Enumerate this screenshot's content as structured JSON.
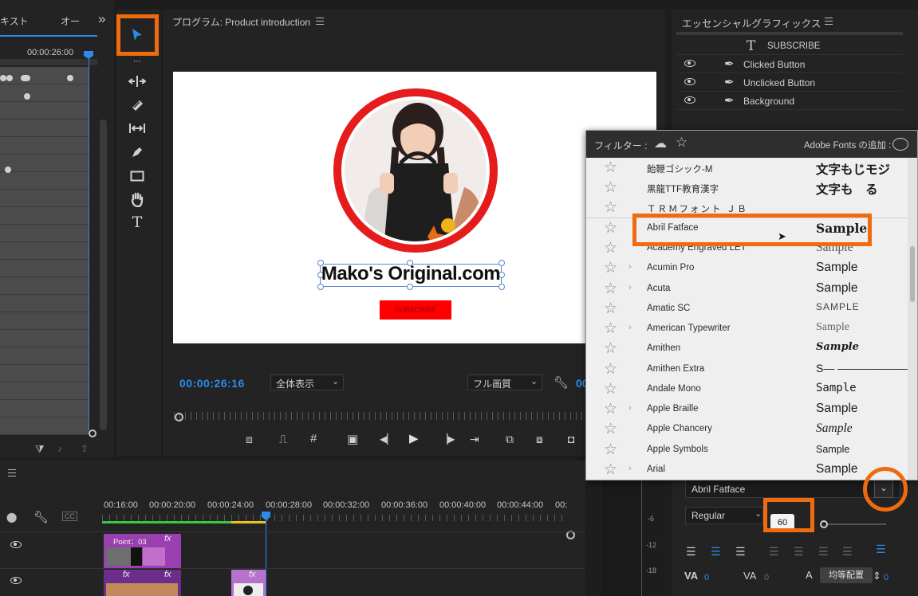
{
  "left_panel": {
    "tab_text": "キスト",
    "tab_audio": "オー",
    "more_glyph": "»",
    "timecode": "00:00:26:00"
  },
  "tools": {
    "items": [
      {
        "name": "selection-tool",
        "glyph": "➤"
      },
      {
        "name": "track-select-tool",
        "glyph": "⇶"
      },
      {
        "name": "ripple-edit-tool",
        "glyph": "✥"
      },
      {
        "name": "razor-tool",
        "glyph": "✂"
      },
      {
        "name": "slip-tool",
        "glyph": "↔"
      },
      {
        "name": "pen-tool",
        "glyph": "✒"
      },
      {
        "name": "rectangle-tool",
        "glyph": "▭"
      },
      {
        "name": "hand-tool",
        "glyph": "✋"
      },
      {
        "name": "type-tool",
        "glyph": "T"
      }
    ]
  },
  "program": {
    "title": "プログラム: Product introduction",
    "canvas_text": "Mako's Original.com",
    "subscribe_label": "SUBSCRIBE",
    "timecode": "00:00:26:16",
    "fit_select": "全体表示",
    "quality_select": "フル画質",
    "timecode_right": "00"
  },
  "essential_graphics": {
    "title": "エッセンシャルグラフィックス",
    "layers": [
      {
        "label": "SUBSCRIBE",
        "type": "text"
      },
      {
        "label": "Clicked Button",
        "type": "shape"
      },
      {
        "label": "Unclicked Button",
        "type": "shape"
      },
      {
        "label": "Background",
        "type": "shape"
      }
    ],
    "font_value": "Abril Fatface",
    "style_value": "Regular",
    "size_value": "60",
    "tracking_value": "0",
    "kerning_value": "0",
    "leading_value": "0",
    "tooltip": "均等配置"
  },
  "font_dropdown": {
    "filter_label": "フィルター :",
    "adobe_fonts_label": "Adobe Fonts の追加 :",
    "fonts": [
      {
        "name": "飴鞭ゴシック-M",
        "sample": "文字もじモジ",
        "chev": false
      },
      {
        "name": "黒龍TTF教育漢字",
        "sample": "文字も　る",
        "chev": false
      },
      {
        "name": "ＴＲＭフォント ＪＢ",
        "sample": "",
        "chev": false
      },
      {
        "name": "Abril Fatface",
        "sample": "Sample",
        "chev": false
      },
      {
        "name": "Academy Engraved LET",
        "sample": "Sample",
        "chev": false
      },
      {
        "name": "Acumin Pro",
        "sample": "Sample",
        "chev": true
      },
      {
        "name": "Acuta",
        "sample": "Sample",
        "chev": true
      },
      {
        "name": "Amatic SC",
        "sample": "SAMPLE",
        "chev": false
      },
      {
        "name": "American Typewriter",
        "sample": "Sample",
        "chev": true
      },
      {
        "name": "Amithen",
        "sample": "Sample",
        "chev": false
      },
      {
        "name": "Amithen Extra",
        "sample": "S— ———————",
        "chev": false
      },
      {
        "name": "Andale Mono",
        "sample": "Sample",
        "chev": false
      },
      {
        "name": "Apple Braille",
        "sample": "Sample",
        "chev": true
      },
      {
        "name": "Apple Chancery",
        "sample": "Sample",
        "chev": false
      },
      {
        "name": "Apple Symbols",
        "sample": "Sample",
        "chev": false
      },
      {
        "name": "Arial",
        "sample": "Sample",
        "chev": true
      }
    ]
  },
  "timeline": {
    "ticks": [
      "00:16:00",
      "00:00:20:00",
      "00:00:24:00",
      "00:00:28:00",
      "00:00:32:00",
      "00:00:36:00",
      "00:00:40:00",
      "00:00:44:00",
      "00:"
    ],
    "clip_label": "Point：03",
    "fx": "fx",
    "ruler_marks": [
      "-6",
      "-12",
      "-18"
    ]
  },
  "colors": {
    "accent_orange": "#f06a0f",
    "timecode_blue": "#2d8ceb",
    "clip_purple": "#9a3fb0",
    "subscribe_red": "#ff0000"
  }
}
